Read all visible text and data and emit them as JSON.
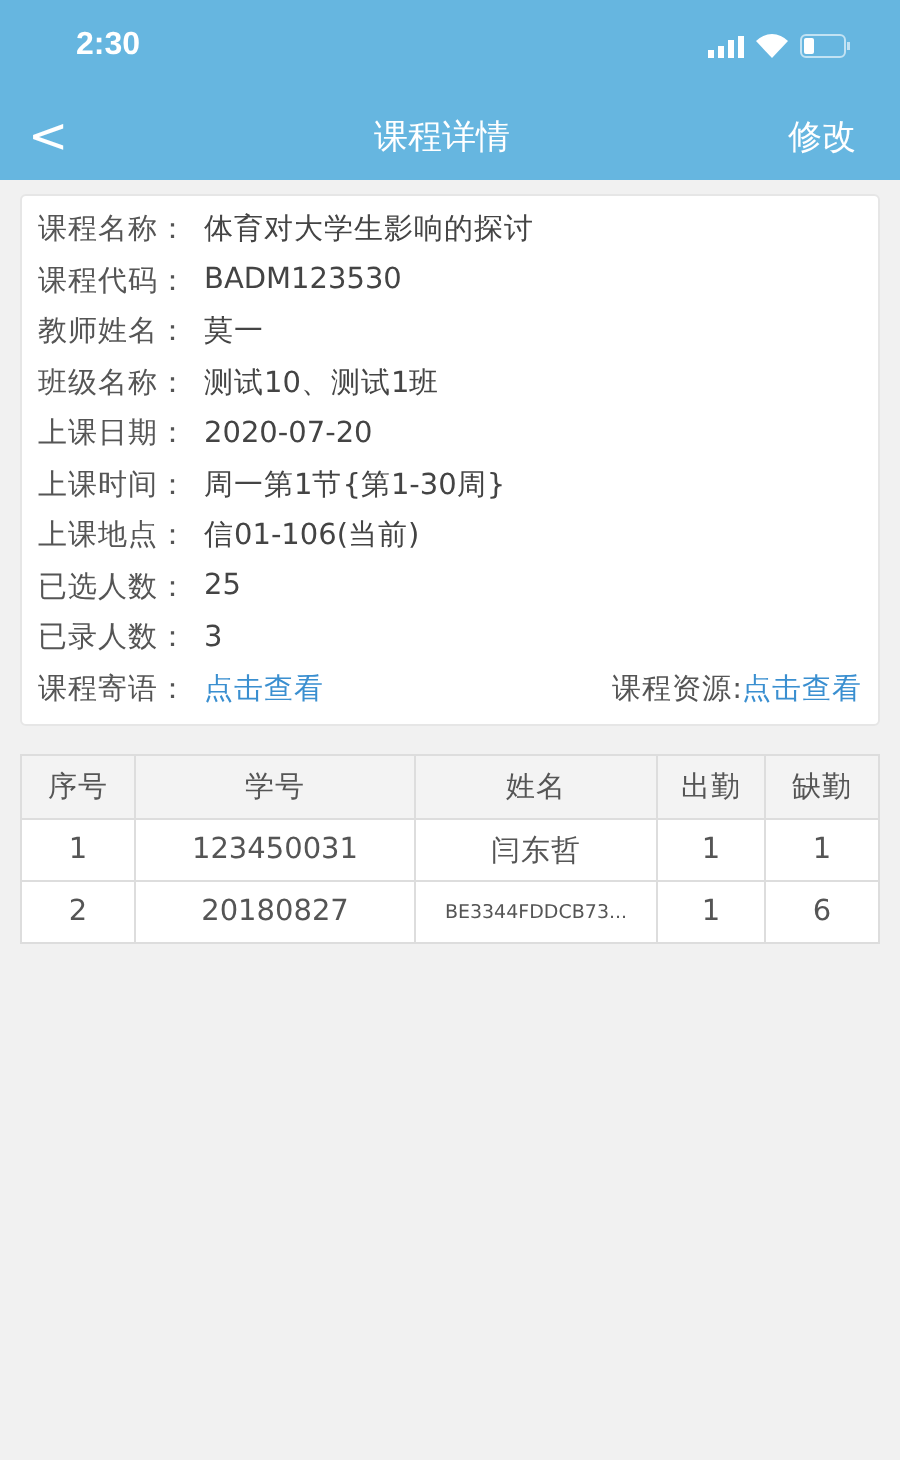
{
  "status_bar": {
    "time": "2:30"
  },
  "nav": {
    "back": "<",
    "title": "课程详情",
    "action": "修改"
  },
  "details": [
    {
      "label": "课程名称：",
      "value": "体育对大学生影响的探讨"
    },
    {
      "label": "课程代码：",
      "value": "BADM123530"
    },
    {
      "label": "教师姓名：",
      "value": "莫一"
    },
    {
      "label": "班级名称：",
      "value": "测试10、测试1班"
    },
    {
      "label": "上课日期：",
      "value": "2020-07-20"
    },
    {
      "label": "上课时间：",
      "value": "周一第1节{第1-30周}"
    },
    {
      "label": "上课地点：",
      "value": "信01-106(当前)"
    },
    {
      "label": "已选人数：",
      "value": "25"
    },
    {
      "label": "已录人数：",
      "value": "3"
    }
  ],
  "links": [
    {
      "label": "课程寄语：",
      "link": "点击查看"
    },
    {
      "label": "课程资源:",
      "link": "点击查看"
    }
  ],
  "table": {
    "columns": [
      "序号",
      "学号",
      "姓名",
      "出勤",
      "缺勤"
    ],
    "rows": [
      [
        "1",
        "123450031",
        "闫东哲",
        "1",
        "1"
      ],
      [
        "2",
        "20180827",
        "BE3344FDDCB73...",
        "1",
        "6"
      ]
    ]
  }
}
